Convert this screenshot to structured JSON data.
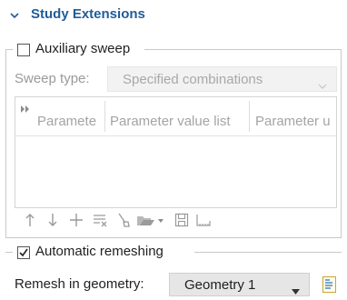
{
  "section": {
    "title": "Study Extensions"
  },
  "aux_sweep": {
    "label": "Auxiliary sweep",
    "checked": false
  },
  "sweep_type": {
    "label": "Sweep type:",
    "value": "Specified combinations"
  },
  "table": {
    "columns": [
      "Paramete",
      "Parameter value list",
      "Parameter u"
    ]
  },
  "auto_remesh": {
    "label": "Automatic remeshing",
    "checked": true
  },
  "remesh": {
    "label": "Remesh in geometry:",
    "value": "Geometry 1"
  },
  "colors": {
    "accent": "#1f5c99",
    "disabled": "#a8a8a8"
  }
}
